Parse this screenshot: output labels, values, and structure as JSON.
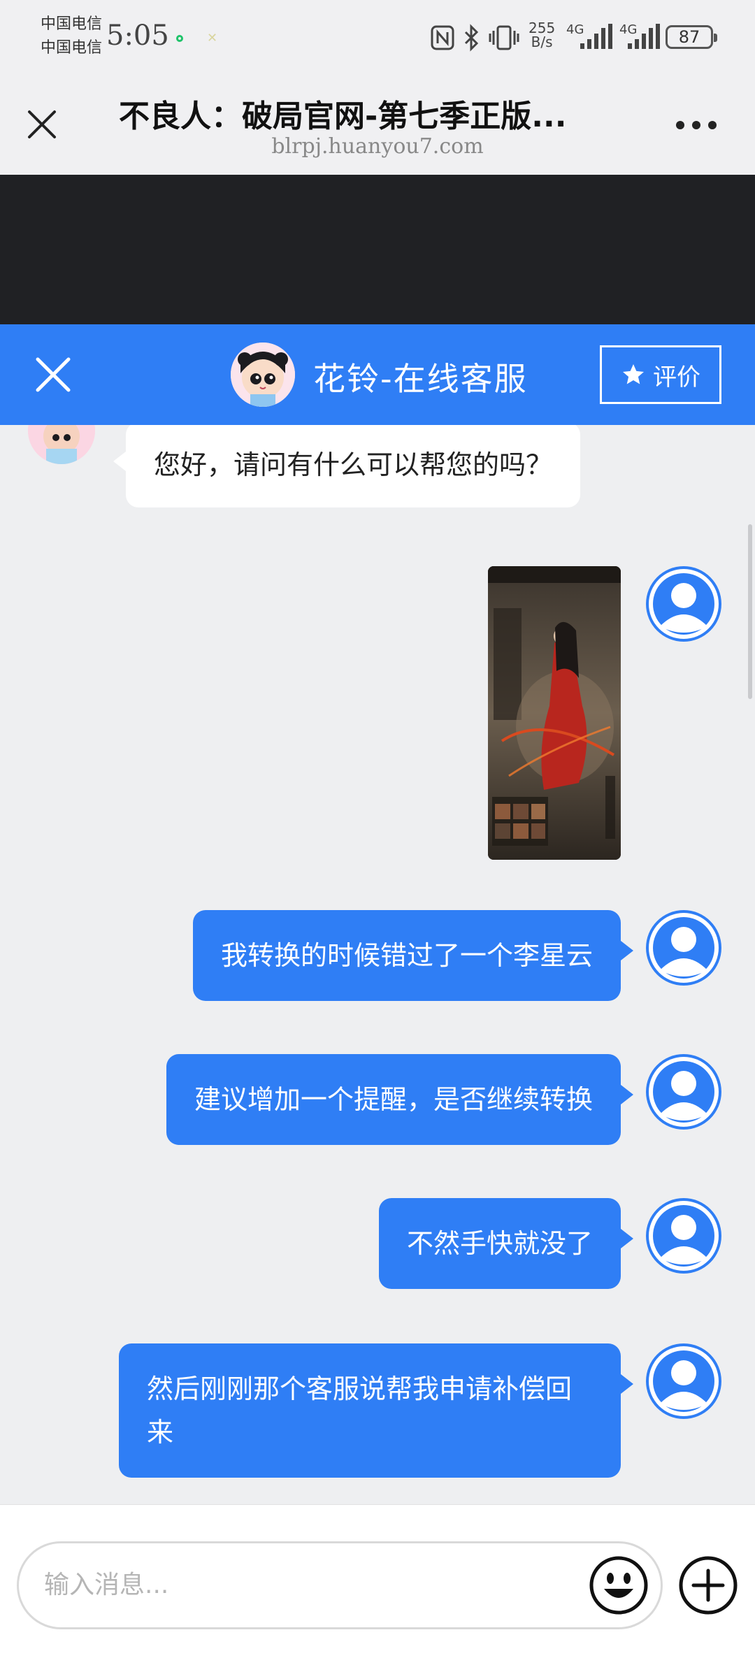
{
  "status_bar": {
    "carrier_1": "中国电信",
    "carrier_2": "中国电信",
    "time": "5:05",
    "net_speed_value": "255",
    "net_speed_unit": "B/s",
    "signal_1": "4G",
    "signal_2": "4G",
    "battery": "87"
  },
  "browser": {
    "title": "不良人：破局官网-第七季正版...",
    "url": "blrpj.huanyou7.com"
  },
  "chat_header": {
    "title": "花铃-在线客服",
    "rate_label": "评价"
  },
  "messages": [
    {
      "from": "agent",
      "type": "text",
      "text": "您好，请问有什么可以帮您的吗？"
    },
    {
      "from": "user",
      "type": "image",
      "icon": "game-screenshot-thumbnail"
    },
    {
      "from": "user",
      "type": "text",
      "text": "我转换的时候错过了一个李星云"
    },
    {
      "from": "user",
      "type": "text",
      "text": "建议增加一个提醒，是否继续转换"
    },
    {
      "from": "user",
      "type": "text",
      "text": "不然手快就没了"
    },
    {
      "from": "user",
      "type": "text",
      "text": "然后刚刚那个客服说帮我申请补偿回来"
    }
  ],
  "composer": {
    "placeholder": "输入消息..."
  },
  "colors": {
    "accent": "#2f7ef5",
    "chat_bg": "#eeeff1",
    "dark_band": "#202124"
  }
}
